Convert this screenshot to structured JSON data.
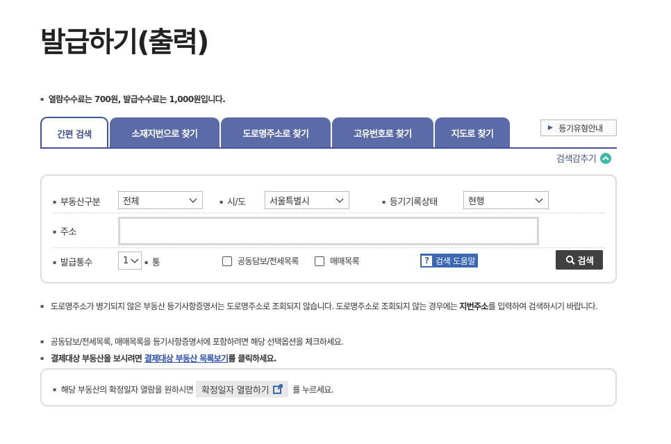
{
  "page": {
    "title": "발급하기(출력)"
  },
  "fee_note": "열람수수료는 700원, 발급수수료는 1,000원입니다.",
  "tabs": [
    {
      "label": "간편 검색",
      "active": true
    },
    {
      "label": "소재지번으로 찾기",
      "active": false
    },
    {
      "label": "도로명주소로 찾기",
      "active": false
    },
    {
      "label": "고유번호로 찾기",
      "active": false
    },
    {
      "label": "지도로 찾기",
      "active": false
    }
  ],
  "guide_button": "등기유형안내",
  "hide_search": "검색감추기",
  "form": {
    "property_type": {
      "label": "부동산구분",
      "value": "전체"
    },
    "region": {
      "label": "시/도",
      "value": "서울특별시"
    },
    "record_status": {
      "label": "등기기록상태",
      "value": "현행"
    },
    "address": {
      "label": "주소",
      "value": ""
    },
    "copies": {
      "label": "발급통수",
      "value": "1",
      "unit": "통"
    },
    "joint_collateral": {
      "label": "공동담보/전세목록",
      "checked": false
    },
    "sale_list": {
      "label": "매매목록",
      "checked": false
    },
    "help_button": {
      "q": "?",
      "label": "검색 도움말"
    },
    "search_button": "검색"
  },
  "notes": {
    "road_address_pre": "도로명주소가 병기되지 않은 부동산 등기사항증명서는 도로명주소로 조회되지 않습니다. 도로명주소로 조회되지 않는 경우에는 ",
    "road_address_bold": "지번주소",
    "road_address_post": "를 입력하여 검색하시기 바랍니다.",
    "options": "공동담보/전세목록, 매매목록을 등기사항증명서에 포함하려면 해당 선택옵션을 체크하세요.",
    "settlement_pre": "결제대상 부동산을 보시려면 ",
    "settlement_link": "결제대상 부동산 목록보기",
    "settlement_post": "를 클릭하세요."
  },
  "info_box": {
    "pre": "해당 부동산의 확정일자 열람을 원하시면",
    "button": "확정일자 열람하기",
    "post": "를 누르세요."
  }
}
